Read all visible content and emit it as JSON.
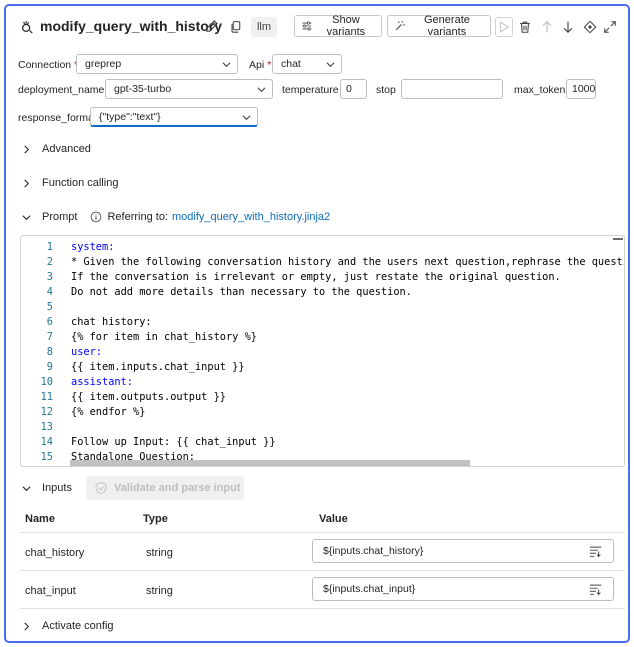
{
  "header": {
    "title": "modify_query_with_history",
    "badge": "llm",
    "show_variants_label": "Show variants",
    "generate_variants_label": "Generate variants"
  },
  "form": {
    "connection_label": "Connection",
    "connection_value": "greprep",
    "api_label": "Api",
    "api_value": "chat",
    "deployment_label": "deployment_name",
    "deployment_value": "gpt-35-turbo",
    "temperature_label": "temperature",
    "temperature_value": "0",
    "stop_label": "stop",
    "stop_value": "",
    "max_tokens_label": "max_tokens",
    "max_tokens_value": "1000",
    "response_format_label": "response_format",
    "response_format_value": "{\"type\":\"text\"}",
    "required_mark": "*"
  },
  "sections": {
    "advanced": "Advanced",
    "function_calling": "Function calling",
    "prompt": "Prompt",
    "referring_to": "Referring to:",
    "prompt_file": "modify_query_with_history.jinja2",
    "inputs": "Inputs",
    "validate_label": "Validate and parse input",
    "activate_config": "Activate config"
  },
  "code_lines": [
    {
      "n": "1",
      "text": "system:",
      "kind": "kw"
    },
    {
      "n": "2",
      "text": "* Given the following conversation history and the users next question,rephrase the question",
      "kind": "plain"
    },
    {
      "n": "3",
      "text": "If the conversation is irrelevant or empty, just restate the original question.",
      "kind": "plain"
    },
    {
      "n": "4",
      "text": "Do not add more details than necessary to the question.",
      "kind": "plain"
    },
    {
      "n": "5",
      "text": "",
      "kind": "plain"
    },
    {
      "n": "6",
      "text": "chat history:",
      "kind": "plain"
    },
    {
      "n": "7",
      "text": "{% for item in chat_history %}",
      "kind": "tmpl"
    },
    {
      "n": "8",
      "text": "user:",
      "kind": "kw"
    },
    {
      "n": "9",
      "text": "{{ item.inputs.chat_input }}",
      "kind": "tmpl"
    },
    {
      "n": "10",
      "text": "assistant:",
      "kind": "kw"
    },
    {
      "n": "11",
      "text": "{{ item.outputs.output }}",
      "kind": "tmpl"
    },
    {
      "n": "12",
      "text": "{% endfor %}",
      "kind": "tmpl"
    },
    {
      "n": "13",
      "text": "",
      "kind": "plain"
    },
    {
      "n": "14",
      "text": "Follow up Input: {{ chat_input }}",
      "kind": "tmplmix"
    },
    {
      "n": "15",
      "text": "Standalone Question:",
      "kind": "plain"
    }
  ],
  "inputs_table": {
    "headers": {
      "name": "Name",
      "type": "Type",
      "value": "Value"
    },
    "rows": [
      {
        "name": "chat_history",
        "type": "string",
        "value": "${inputs.chat_history}"
      },
      {
        "name": "chat_input",
        "type": "string",
        "value": "${inputs.chat_input}"
      }
    ]
  },
  "colors": {
    "accent": "#4f6bed",
    "link": "#0f6cbd",
    "keyword": "#0000ff",
    "line_number": "#237893"
  }
}
